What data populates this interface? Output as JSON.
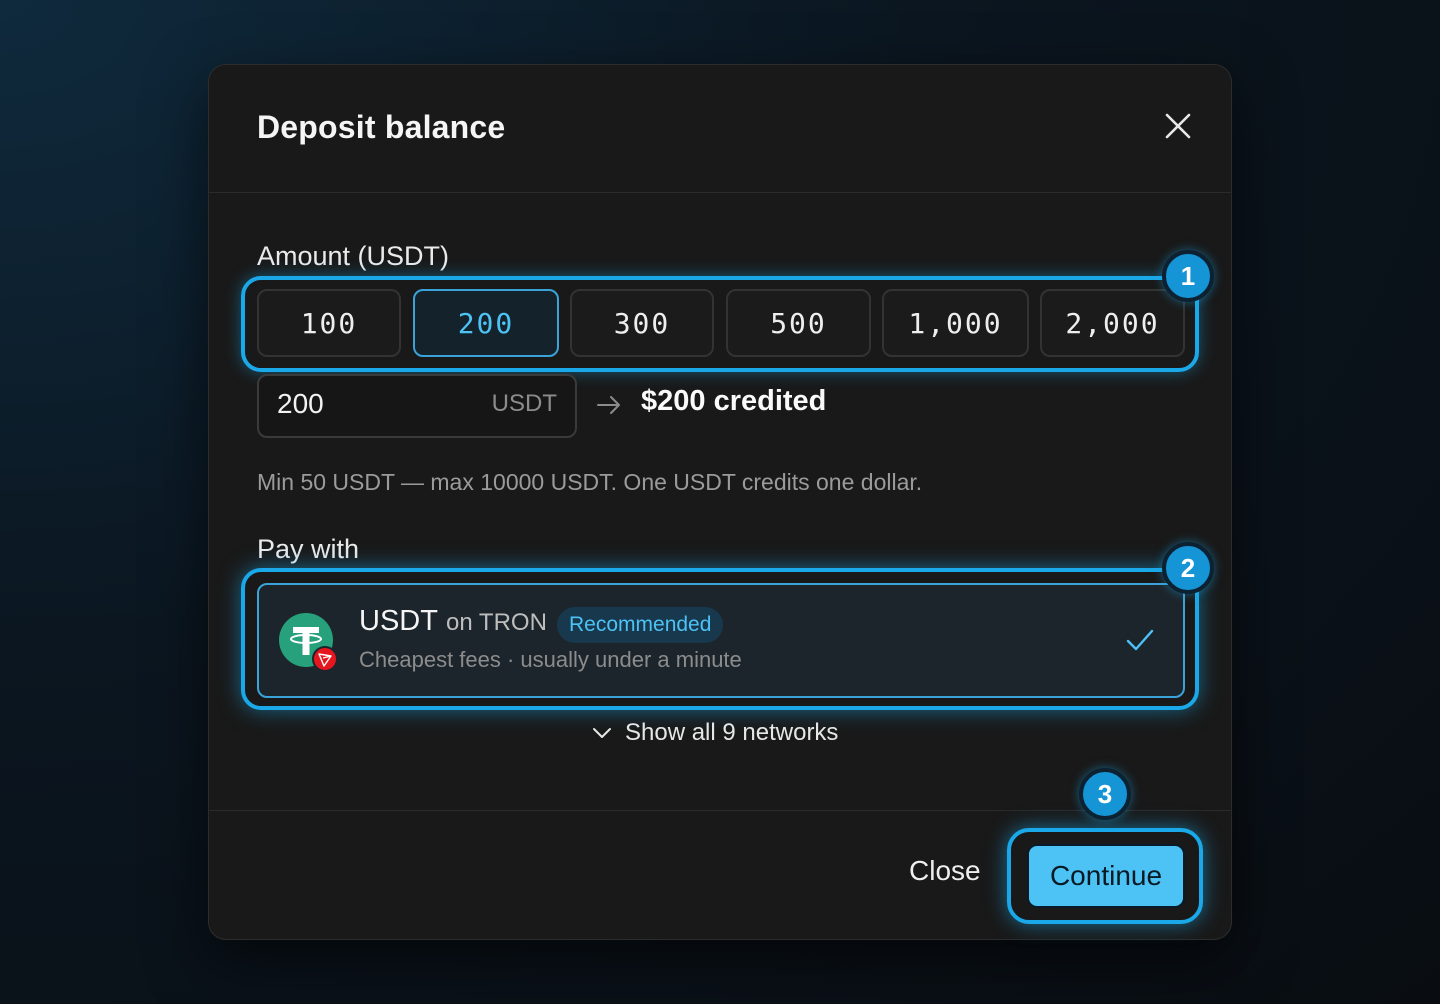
{
  "modal": {
    "title": "Deposit balance"
  },
  "amount": {
    "label": "Amount (USDT)",
    "presets": [
      "100",
      "200",
      "300",
      "500",
      "1,000",
      "2,000"
    ],
    "selected_preset": "200",
    "input_value": "200",
    "input_unit": "USDT",
    "credited_text": "$200 credited",
    "helper": "Min 50 USDT — max 10000 USDT. One USDT credits one dollar."
  },
  "pay": {
    "label": "Pay with",
    "option": {
      "coin": "USDT",
      "network": "on TRON",
      "badge": "Recommended",
      "subtitle": "Cheapest fees · usually under a minute",
      "selected": true
    },
    "show_all": "Show all 9 networks"
  },
  "footer": {
    "close_label": "Close",
    "continue_label": "Continue"
  },
  "steps": [
    "1",
    "2",
    "3"
  ],
  "colors": {
    "accent": "#1aa8e8",
    "button": "#4cc2f5",
    "tether": "#26a17b",
    "tron": "#e5161d"
  },
  "icons": {
    "close": "close-icon",
    "arrow": "arrow-right-icon",
    "check": "check-icon",
    "chevron": "chevron-down-icon"
  }
}
